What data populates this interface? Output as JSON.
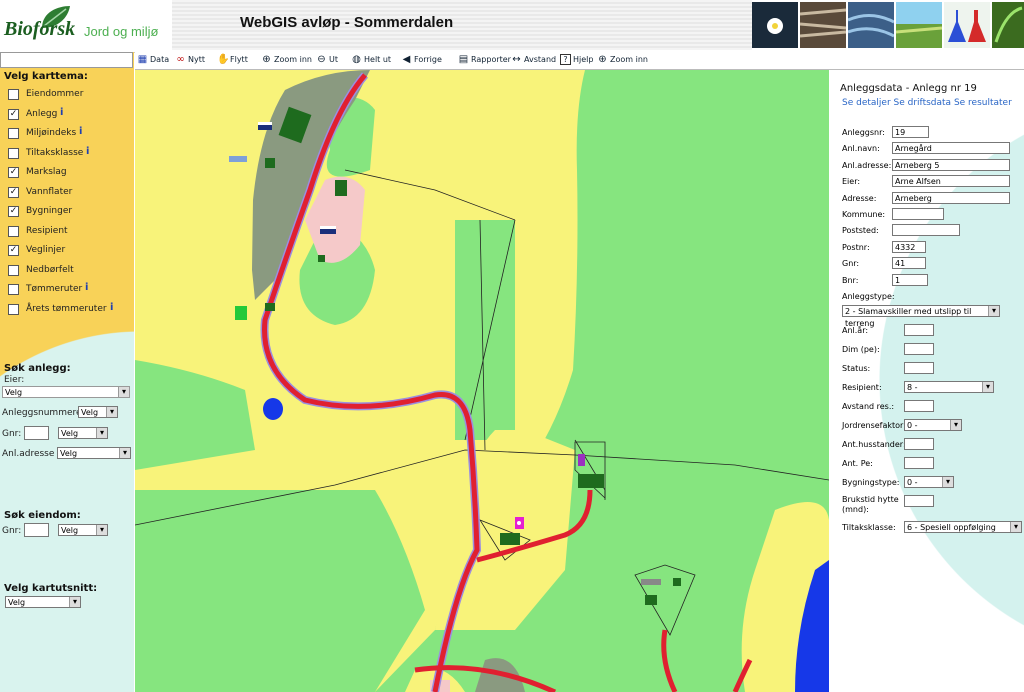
{
  "header": {
    "logo_text": "Bioforsk",
    "logo_tagline": "Jord og miljø",
    "title": "WebGIS avløp - Sommerdalen"
  },
  "toolbar": [
    "Data",
    "Nytt",
    "Flytt",
    "Zoom inn",
    "Ut",
    "Helt ut",
    "Forrige",
    "Rapporter",
    "Avstand",
    "Hjelp",
    "Zoom inn"
  ],
  "left": {
    "themes_heading": "Velg karttema:",
    "themes": [
      {
        "label": "Eiendommer",
        "checked": false,
        "info": false
      },
      {
        "label": "Anlegg",
        "checked": true,
        "info": true
      },
      {
        "label": "Miljøindeks",
        "checked": false,
        "info": true
      },
      {
        "label": "Tiltaksklasse",
        "checked": false,
        "info": true
      },
      {
        "label": "Markslag",
        "checked": true,
        "info": false
      },
      {
        "label": "Vannflater",
        "checked": true,
        "info": false
      },
      {
        "label": "Bygninger",
        "checked": true,
        "info": false
      },
      {
        "label": "Resipient",
        "checked": false,
        "info": false
      },
      {
        "label": "Veglinjer",
        "checked": true,
        "info": false
      },
      {
        "label": "Nedbørfelt",
        "checked": false,
        "info": false
      },
      {
        "label": "Tømmeruter",
        "checked": false,
        "info": true
      },
      {
        "label": "Årets tømmeruter",
        "checked": false,
        "info": true
      }
    ],
    "search_facility_heading": "Søk anlegg:",
    "owner_label": "Eier:",
    "owner_value": "Velg",
    "facility_number_label": "Anleggsnummeret:",
    "facility_number_value": "Velg",
    "gnr_label": "Gnr:",
    "gnr_value": "Velg",
    "address_label": "Anl.adresse :",
    "address_value": "Velg",
    "search_property_heading": "Søk eiendom:",
    "prop_gnr_label": "Gnr:",
    "prop_gnr_value": "Velg",
    "extent_heading": "Velg kartutsnitt:",
    "extent_value": "Velg"
  },
  "right": {
    "heading": "Anleggsdata - Anlegg nr 19",
    "links": [
      "Se detaljer",
      "Se driftsdata",
      "Se resultater"
    ],
    "fields": [
      {
        "label": "Anleggsnr:",
        "value": "19"
      },
      {
        "label": "Anl.navn:",
        "value": "Arnegård"
      },
      {
        "label": "Anl.adresse:",
        "value": "Arneberg 5"
      },
      {
        "label": "Eier:",
        "value": "Arne Alfsen"
      },
      {
        "label": "Adresse:",
        "value": "Arneberg"
      },
      {
        "label": "Kommune:",
        "value": ""
      },
      {
        "label": "Poststed:",
        "value": ""
      },
      {
        "label": "Postnr:",
        "value": "4332"
      },
      {
        "label": "Gnr:",
        "value": "41"
      },
      {
        "label": "Bnr:",
        "value": "1"
      }
    ],
    "type_label": "Anleggstype:",
    "type_value": "2 - Slamavskiller med utslipp til terreng",
    "fields2": [
      {
        "label": "Anl.år:",
        "value": "",
        "kind": "input"
      },
      {
        "label": "Dim (pe):",
        "value": "",
        "kind": "input"
      },
      {
        "label": "Status:",
        "value": "",
        "kind": "input"
      },
      {
        "label": "Resipient:",
        "value": "8 -",
        "kind": "select"
      },
      {
        "label": "Avstand res.:",
        "value": "",
        "kind": "input"
      },
      {
        "label": "Jordrensefaktor:",
        "value": "0 -",
        "kind": "select"
      },
      {
        "label": "Ant.husstander:",
        "value": "",
        "kind": "input"
      },
      {
        "label": "Ant. Pe:",
        "value": "",
        "kind": "input"
      },
      {
        "label": "Bygningstype:",
        "value": "0 -",
        "kind": "select"
      },
      {
        "label": "Brukstid hytte (mnd):",
        "value": "",
        "kind": "input"
      },
      {
        "label": "Tiltaksklasse:",
        "value": "6 - Spesiell oppfølging",
        "kind": "select"
      }
    ]
  },
  "colors": {
    "map_green": "#86e57f",
    "map_yellow": "#f8f37a",
    "map_forest": "#8a9a80",
    "road": "#e02030",
    "water": "#1638e8"
  }
}
